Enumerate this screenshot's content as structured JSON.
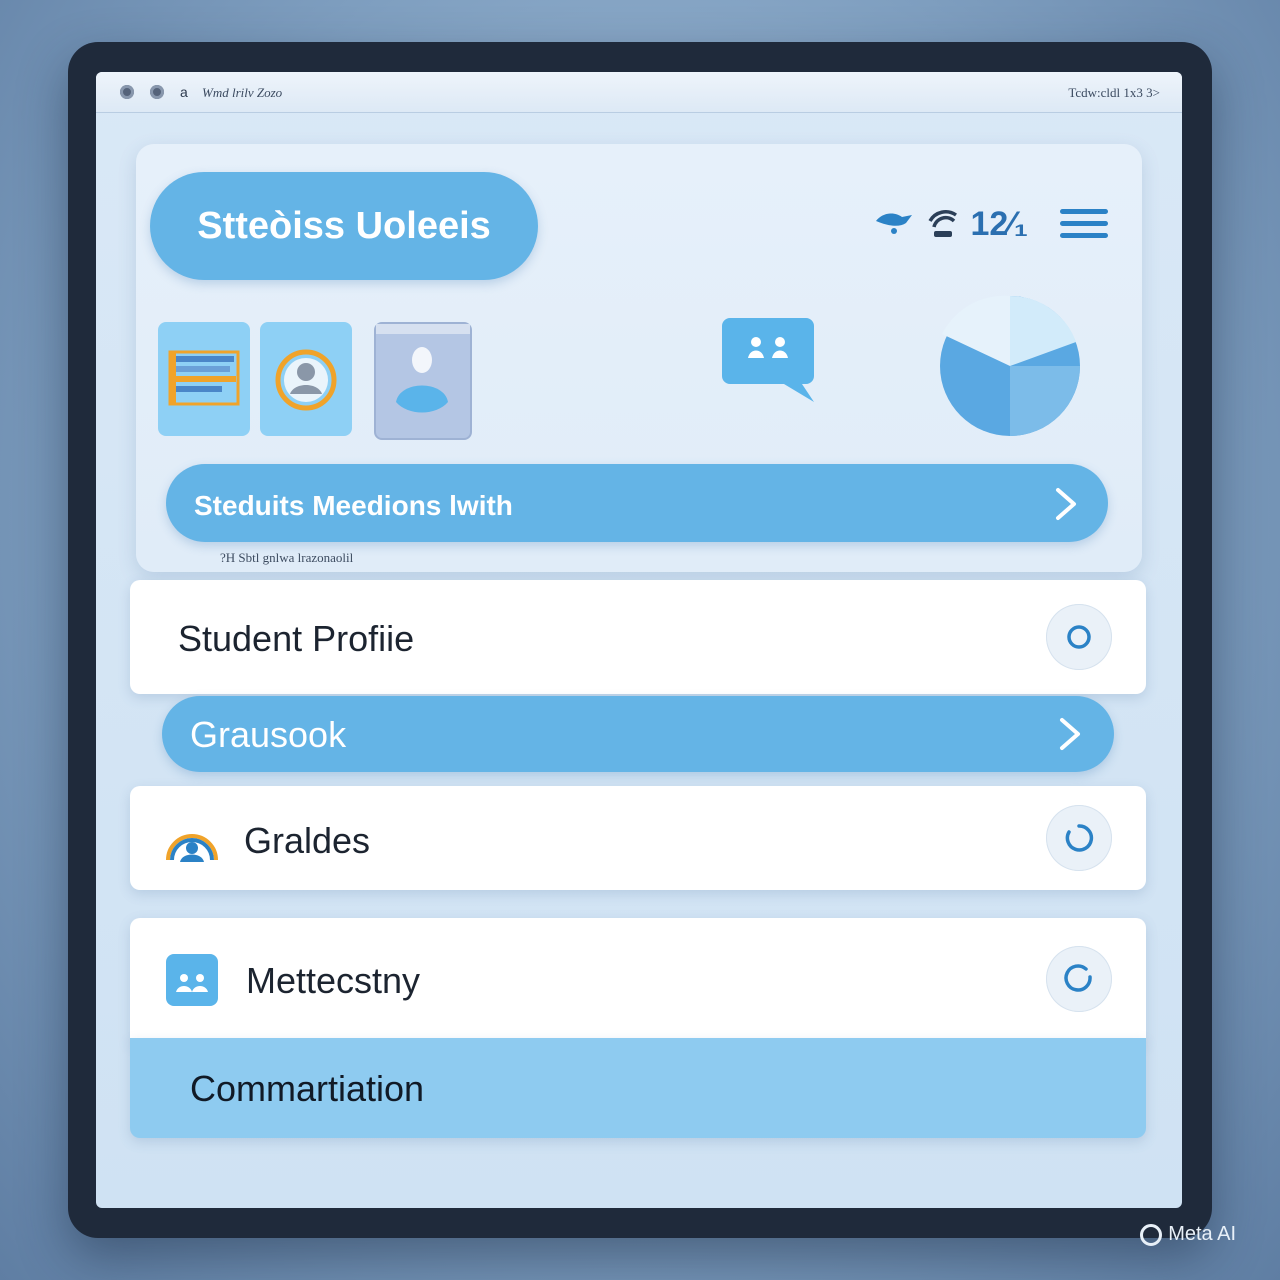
{
  "window": {
    "title_prefix": "a",
    "title": "Wmd lrilv Zozo",
    "right_text": "Tcdw:cldl 1x3 3>"
  },
  "hero": {
    "app_title": "Stteòiss Uoleeis",
    "status_time": "12⁄₁",
    "cta_label": "Steduits Meedions lwith",
    "note": "?H  Sbtl  gnlwa  lrazonaolil"
  },
  "list": {
    "student_profile": "Student Profiie",
    "grausook": "Grausook",
    "grades": "Graldes",
    "mettecstry": "Mettecstny",
    "commartiation": "Commartiation"
  },
  "colors": {
    "accent": "#64b4e6",
    "accent_light": "#8ecbf0",
    "icon_blue": "#2b82c6",
    "icon_orange": "#f0a32a"
  },
  "icons": [
    "wifi-icon",
    "signal-icon",
    "menu-icon",
    "chat-icon",
    "pie-chart-icon",
    "chevron-right-icon",
    "radio-icon",
    "gauge-icon",
    "people-icon"
  ],
  "watermark": "Meta AI"
}
